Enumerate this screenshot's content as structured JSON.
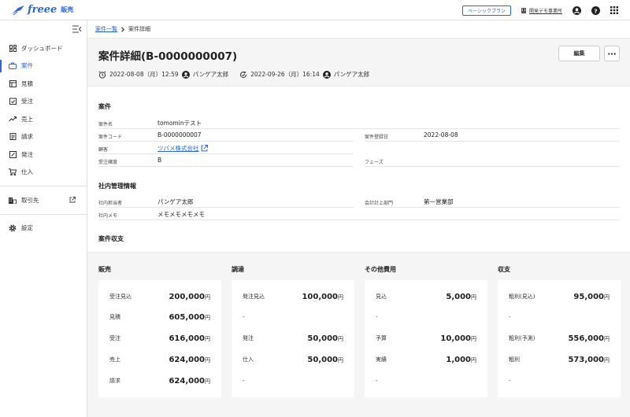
{
  "header": {
    "logo_text": "freee",
    "logo_sub": "販売",
    "plan_badge": "ベーシックプラン",
    "office": "開発デモ事業所"
  },
  "sidebar": {
    "items": [
      {
        "label": "ダッシュボード",
        "icon": "dashboard-icon"
      },
      {
        "label": "案件",
        "icon": "briefcase-icon",
        "active": true
      },
      {
        "label": "見積",
        "icon": "estimate-icon"
      },
      {
        "label": "受注",
        "icon": "order-check-icon"
      },
      {
        "label": "売上",
        "icon": "trend-up-icon"
      },
      {
        "label": "請求",
        "icon": "invoice-icon"
      },
      {
        "label": "発注",
        "icon": "purchase-order-icon"
      },
      {
        "label": "仕入",
        "icon": "cart-icon"
      }
    ],
    "partners": "取引先",
    "settings": "設定"
  },
  "breadcrumb": {
    "parent": "案件一覧",
    "current": "案件詳細"
  },
  "title": "案件詳細(B-0000000007)",
  "meta": {
    "created_at": "2022-08-08（月）12:59",
    "created_by": "パンゲア太郎",
    "updated_at": "2022-09-26（月）16:14",
    "updated_by": "パンゲア太郎"
  },
  "buttons": {
    "edit": "編集"
  },
  "project": {
    "heading": "案件",
    "name_label": "案件名",
    "name": "tomominテスト",
    "code_label": "案件コード",
    "code": "B-0000000007",
    "registered_label": "案件登録日",
    "registered": "2022-08-08",
    "customer_label": "顧客",
    "customer": "ツバメ株式会社",
    "certainty_label": "受注確度",
    "certainty": "B",
    "phase_label": "フェーズ",
    "phase": ""
  },
  "internal": {
    "heading": "社内管理情報",
    "staff_label": "社内担当者",
    "staff": "パンゲア太郎",
    "dept_label": "会計計上部門",
    "dept": "第一営業部",
    "memo_label": "社内メモ",
    "memo": "メモメモメモメモ"
  },
  "finance": {
    "heading": "案件収支",
    "unit": "円",
    "columns": [
      {
        "title": "販売",
        "rows": [
          {
            "label": "受注見込",
            "value": "200,000"
          },
          {
            "label": "見積",
            "value": "605,000"
          },
          {
            "label": "受注",
            "value": "616,000"
          },
          {
            "label": "売上",
            "value": "624,000"
          },
          {
            "label": "請求",
            "value": "624,000"
          }
        ]
      },
      {
        "title": "調達",
        "rows": [
          {
            "label": "発注見込",
            "value": "100,000"
          },
          {
            "label": "-",
            "value": ""
          },
          {
            "label": "発注",
            "value": "50,000"
          },
          {
            "label": "仕入",
            "value": "50,000"
          },
          {
            "label": "-",
            "value": ""
          }
        ]
      },
      {
        "title": "その他費用",
        "rows": [
          {
            "label": "見込",
            "value": "5,000"
          },
          {
            "label": "-",
            "value": ""
          },
          {
            "label": "予算",
            "value": "10,000"
          },
          {
            "label": "実績",
            "value": "1,000"
          },
          {
            "label": "-",
            "value": ""
          }
        ]
      },
      {
        "title": "収支",
        "rows": [
          {
            "label": "粗利(見込)",
            "value": "95,000"
          },
          {
            "label": "-",
            "value": ""
          },
          {
            "label": "粗利(予測)",
            "value": "556,000"
          },
          {
            "label": "粗利",
            "value": "573,000"
          },
          {
            "label": "-",
            "value": ""
          }
        ]
      }
    ]
  }
}
